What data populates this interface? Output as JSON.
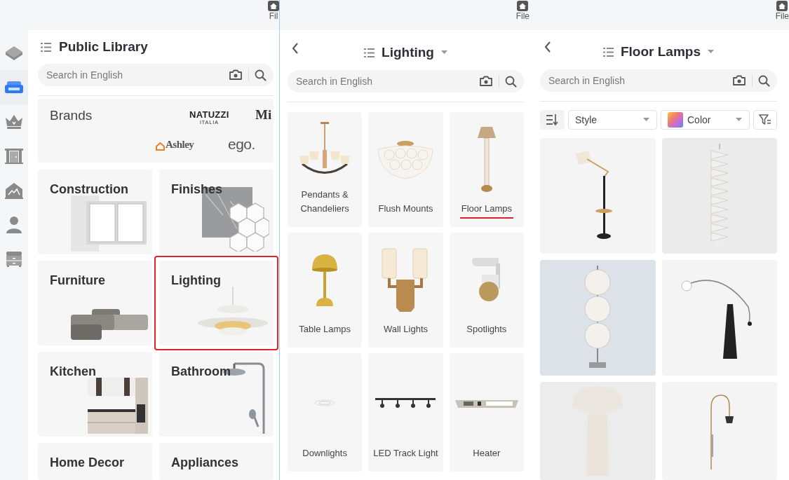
{
  "rail": {
    "items": [
      {
        "selected": false
      },
      {
        "selected": true
      },
      {
        "selected": false
      },
      {
        "selected": false
      },
      {
        "selected": false
      },
      {
        "selected": false
      },
      {
        "selected": false
      }
    ]
  },
  "library": {
    "file_label": "Fil",
    "title": "Public Library",
    "search": {
      "placeholder": "Search in English"
    },
    "brands": {
      "label": "Brands",
      "logos": [
        {
          "kind": "natuzzi",
          "text": "NATUZZI",
          "subtext": "ITALIA"
        },
        {
          "kind": "serif",
          "text": "Mi"
        },
        {
          "kind": "ashley",
          "text": "Ashley"
        },
        {
          "kind": "ego",
          "text": "ego."
        }
      ]
    },
    "tiles": [
      {
        "label": "Construction",
        "selected": false
      },
      {
        "label": "Finishes",
        "selected": false
      },
      {
        "label": "Furniture",
        "selected": false
      },
      {
        "label": "Lighting",
        "selected": true
      },
      {
        "label": "Kitchen",
        "selected": false
      },
      {
        "label": "Bathroom",
        "selected": false
      },
      {
        "label": "Home Decor",
        "selected": false
      },
      {
        "label": "Appliances",
        "selected": false
      }
    ]
  },
  "lighting": {
    "file_label": "File",
    "title": "Lighting",
    "search": {
      "placeholder": "Search in English"
    },
    "categories": [
      {
        "label": "Pendants & Chandeliers",
        "selected": false
      },
      {
        "label": "Flush Mounts",
        "selected": false
      },
      {
        "label": "Floor Lamps",
        "selected": true
      },
      {
        "label": "Table Lamps",
        "selected": false
      },
      {
        "label": "Wall Lights",
        "selected": false
      },
      {
        "label": "Spotlights",
        "selected": false
      },
      {
        "label": "Downlights",
        "selected": false
      },
      {
        "label": "LED Track Light",
        "selected": false
      },
      {
        "label": "Heater",
        "selected": false
      }
    ]
  },
  "floor_lamps": {
    "file_label": "File",
    "title": "Floor Lamps",
    "search": {
      "placeholder": "Search in English"
    },
    "filters": {
      "style_label": "Style",
      "color_label": "Color"
    },
    "products": [
      {
        "kind": "arm"
      },
      {
        "kind": "column"
      },
      {
        "kind": "globes"
      },
      {
        "kind": "arc"
      },
      {
        "kind": "mushroom"
      },
      {
        "kind": "hook"
      }
    ]
  }
}
